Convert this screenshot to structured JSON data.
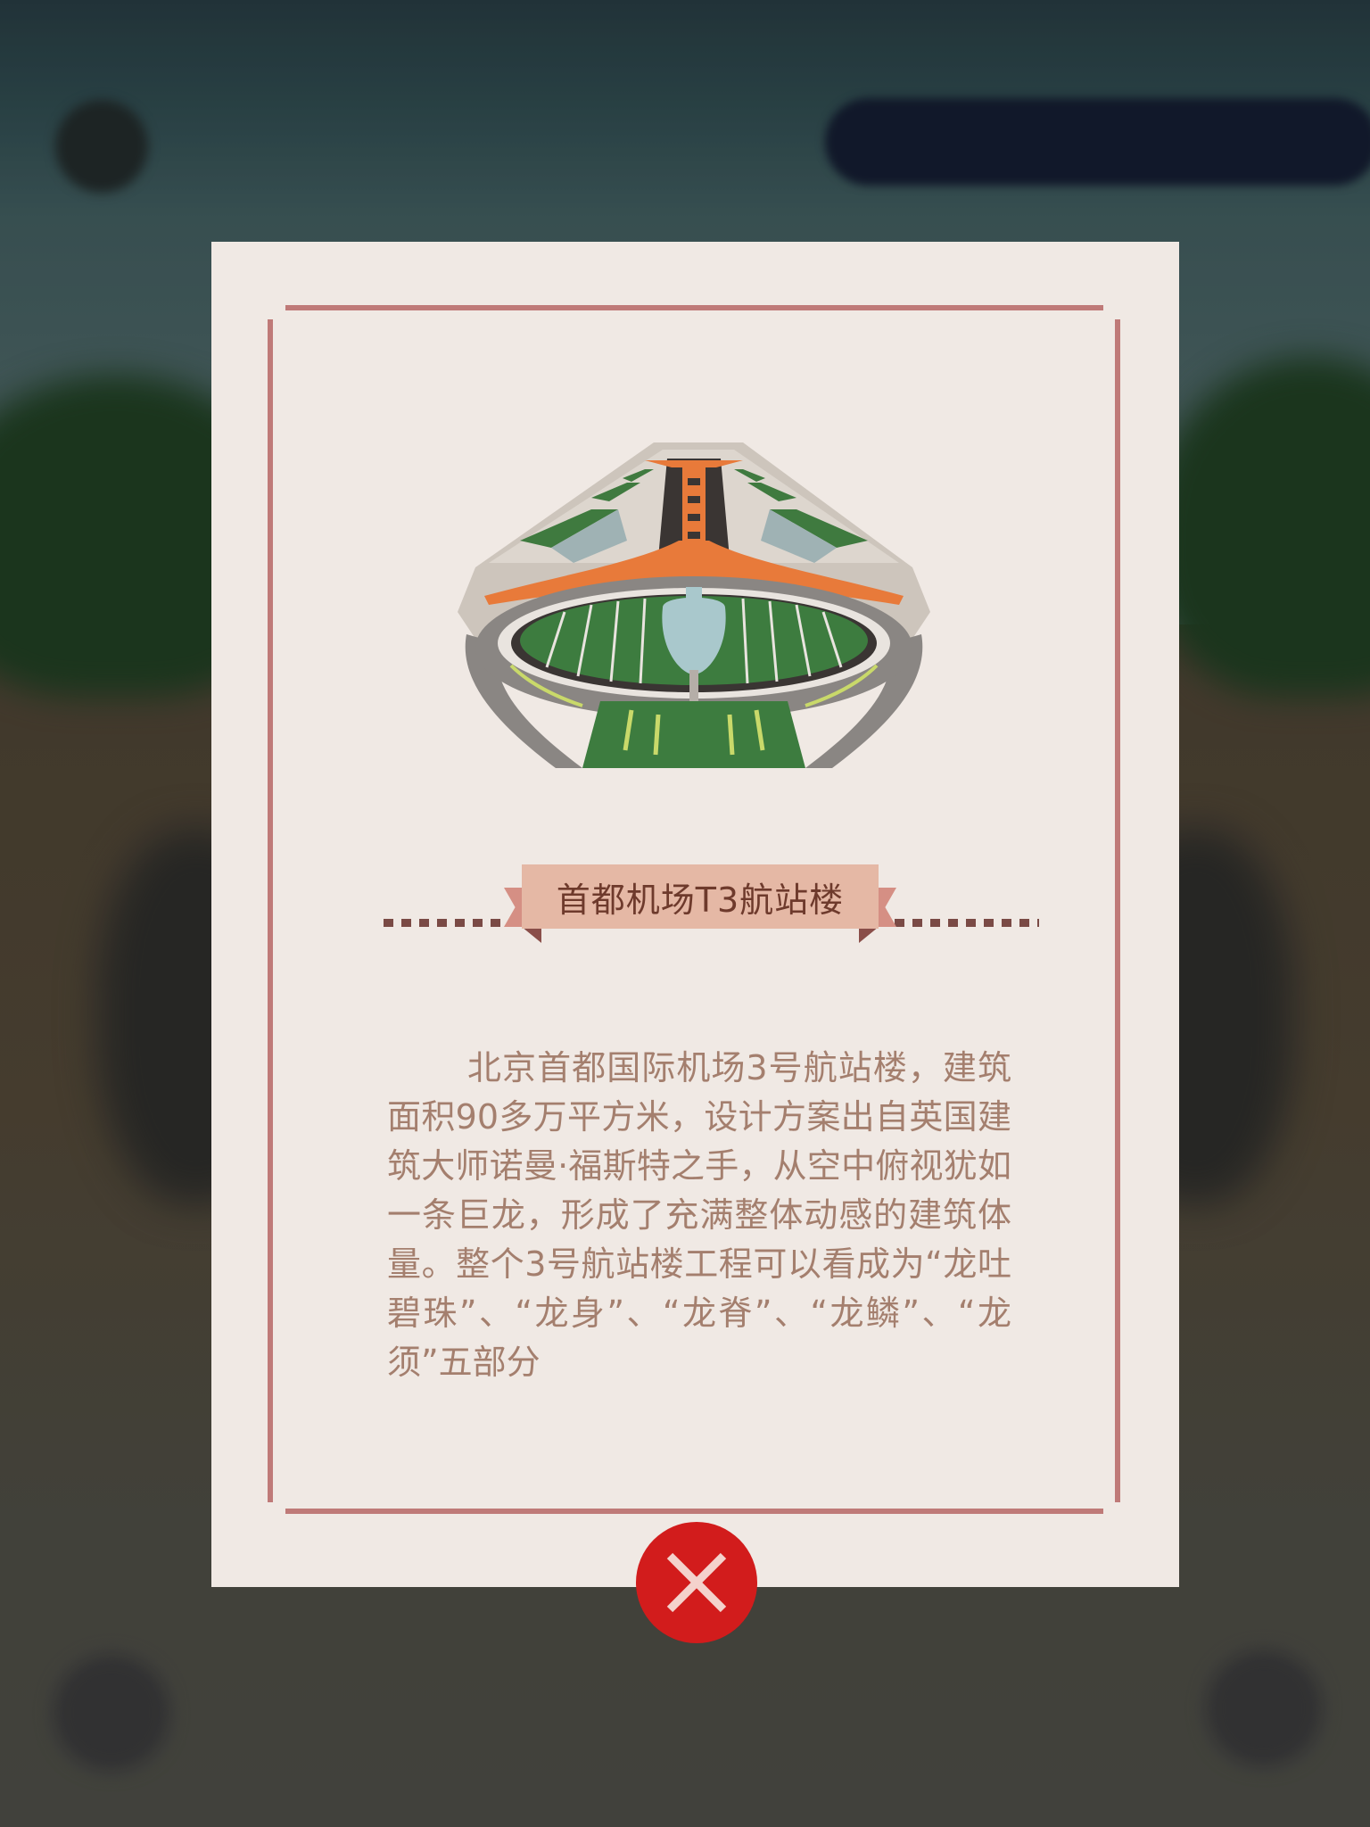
{
  "modal": {
    "title": "首都机场T3航站楼",
    "description": "北京首都国际机场3号航站楼，建筑面积90多万平方米，设计方案出自英国建筑大师诺曼·福斯特之手，从空中俯视犹如一条巨龙，形成了充满整体动感的建筑体量。整个3号航站楼工程可以看成为“龙吐碧珠”、“龙身”、“龙脊”、“龙鳞”、“龙须”五部分",
    "illustration_icon": "airport-terminal-illustration",
    "close_icon": "close-icon"
  },
  "colors": {
    "card_background": "#f0e9e4",
    "frame": "#bf7a78",
    "ribbon": "#e5b8a5",
    "title_text": "#6e3a2c",
    "body_text": "#a47f6e",
    "close_button": "#d21c1c"
  }
}
